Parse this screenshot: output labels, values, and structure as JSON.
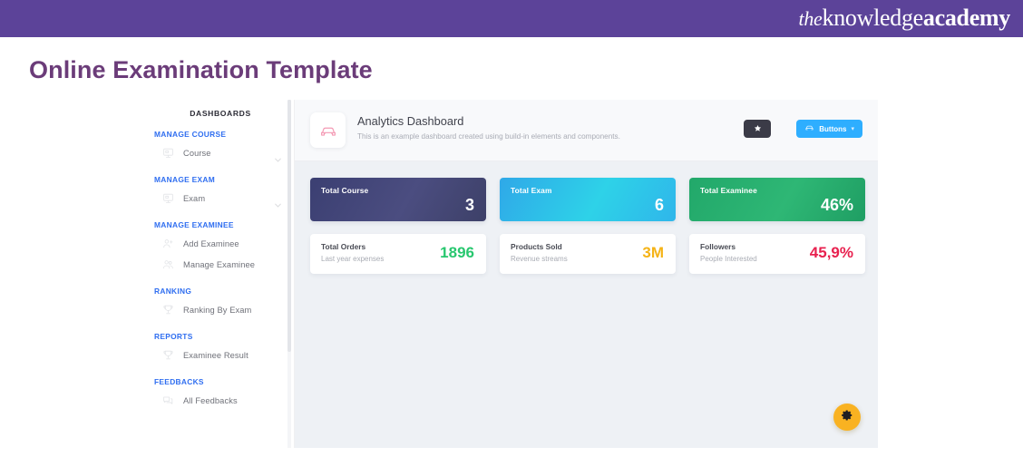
{
  "brand": {
    "prefix": "the",
    "light": "knowledge",
    "bold": "academy",
    "bar_color": "#5c4399"
  },
  "page": {
    "title": "Online Examination Template",
    "title_color": "#6b3c79"
  },
  "sidebar": {
    "title": "DASHBOARDS",
    "heading_color": "#2f6ef0",
    "groups": [
      {
        "heading": "MANAGE COURSE",
        "items": [
          {
            "label": "Course",
            "icon": "monitor-icon",
            "chevron": true
          }
        ]
      },
      {
        "heading": "MANAGE EXAM",
        "items": [
          {
            "label": "Exam",
            "icon": "monitor-icon",
            "chevron": true
          }
        ]
      },
      {
        "heading": "MANAGE EXAMINEE",
        "items": [
          {
            "label": "Add Examinee",
            "icon": "user-plus-icon",
            "chevron": false
          },
          {
            "label": "Manage Examinee",
            "icon": "users-icon",
            "chevron": false
          }
        ]
      },
      {
        "heading": "RANKING",
        "items": [
          {
            "label": "Ranking By Exam",
            "icon": "trophy-icon",
            "chevron": false
          }
        ]
      },
      {
        "heading": "REPORTS",
        "items": [
          {
            "label": "Examinee Result",
            "icon": "trophy-icon",
            "chevron": false
          }
        ]
      },
      {
        "heading": "FEEDBACKS",
        "items": [
          {
            "label": "All Feedbacks",
            "icon": "chat-icon",
            "chevron": false
          }
        ]
      }
    ]
  },
  "header": {
    "icon": "car-icon",
    "title": "Analytics Dashboard",
    "subtitle": "This is an example dashboard created using build-in elements and components.",
    "star_button": {
      "name": "star-icon",
      "bg": "#3b3b47"
    },
    "dropdown": {
      "label": "Buttons",
      "icon": "car-icon",
      "caret": "▾",
      "bg": "#2eaeff"
    }
  },
  "stat_cards": [
    {
      "label": "Total Course",
      "value": "3",
      "bg": "linear-gradient(120deg,#3b3f72 0%,#4b4d80 55%,#3d4068 100%)"
    },
    {
      "label": "Total Exam",
      "value": "6",
      "bg": "linear-gradient(120deg,#2fa8e8 0%,#2ed2e8 55%,#2fb6ea 100%)"
    },
    {
      "label": "Total Examinee",
      "value": "46%",
      "bg": "linear-gradient(120deg,#22a86a 0%,#2eb775 55%,#1f9e63 100%)"
    }
  ],
  "info_cards": [
    {
      "label": "Total Orders",
      "sub": "Last year expenses",
      "value": "1896",
      "value_color": "#28c76f"
    },
    {
      "label": "Products Sold",
      "sub": "Revenue streams",
      "value": "3M",
      "value_color": "#f5b316"
    },
    {
      "label": "Followers",
      "sub": "People Interested",
      "value": "45,9%",
      "value_color": "#e8214f"
    }
  ],
  "fab": {
    "name": "gear-icon",
    "bg": "#f9b221"
  }
}
